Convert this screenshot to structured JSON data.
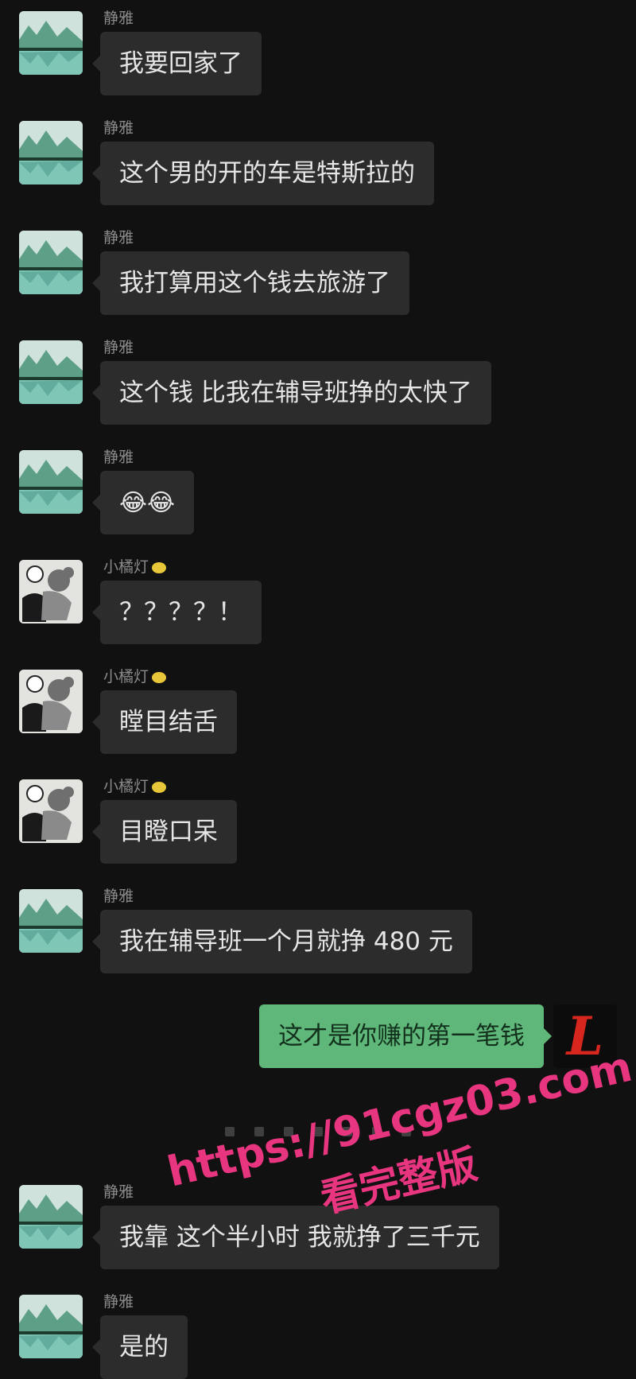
{
  "messages": [
    {
      "sender": "静雅",
      "text": "我要回家了"
    },
    {
      "sender": "静雅",
      "text": "这个男的开的车是特斯拉的"
    },
    {
      "sender": "静雅",
      "text": "我打算用这个钱去旅游了"
    },
    {
      "sender": "静雅",
      "text": "这个钱 比我在辅导班挣的太快了"
    },
    {
      "sender": "静雅",
      "text": "😂😂"
    },
    {
      "sender": "小橘灯",
      "text": "？？？？！"
    },
    {
      "sender": "小橘灯",
      "text": "瞠目结舌"
    },
    {
      "sender": "小橘灯",
      "text": "目瞪口呆"
    },
    {
      "sender": "静雅",
      "text": "我在辅导班一个月就挣 480 元"
    },
    {
      "sender": "me",
      "text": "这才是你赚的第一笔钱"
    },
    {
      "sender": "静雅",
      "text": "我靠 这个半小时 我就挣了三千元"
    },
    {
      "sender": "静雅",
      "text": "是的"
    }
  ],
  "my_avatar_letter": "L",
  "watermark": {
    "url": "https://91cgz03.com",
    "cta": "看完整版"
  },
  "colors": {
    "background": "#111111",
    "bubble_incoming": "#2c2c2c",
    "bubble_outgoing": "#5fb87a",
    "watermark": "#e8357f"
  }
}
